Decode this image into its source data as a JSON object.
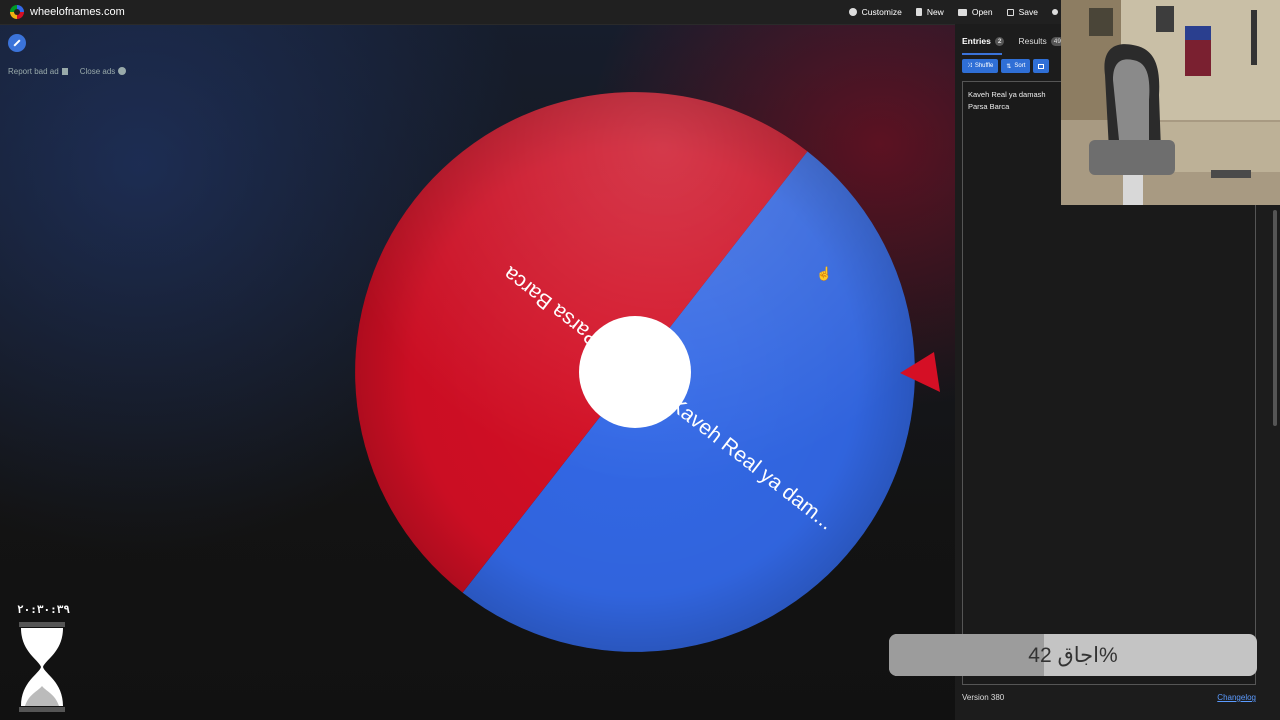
{
  "app": {
    "site_name": "wheelofnames.com"
  },
  "nav": {
    "customize": "Customize",
    "new": "New",
    "open": "Open",
    "save": "Save"
  },
  "ads": {
    "report": "Report bad ad",
    "close": "Close ads"
  },
  "wheel": {
    "segments": [
      {
        "label": "Kaveh Real ya dam...",
        "color": "#3369e8"
      },
      {
        "label": "Parsa Barca",
        "color": "#d50f25"
      }
    ],
    "center_color": "#ffffff",
    "pointer_color": "#d50f25"
  },
  "timer": {
    "value": "۲۰:۳۰:۳۹"
  },
  "panel": {
    "tabs": [
      {
        "label": "Entries",
        "count": "2"
      },
      {
        "label": "Results",
        "count": "49"
      }
    ],
    "tools": {
      "shuffle": "Shuffle",
      "sort": "Sort"
    },
    "entries": [
      "Kaveh Real ya damash",
      "Parsa Barca"
    ],
    "version": "Version 380",
    "changelog": "Changelog"
  },
  "loading": {
    "text": "اجاق 42%",
    "progress": 0.42
  }
}
